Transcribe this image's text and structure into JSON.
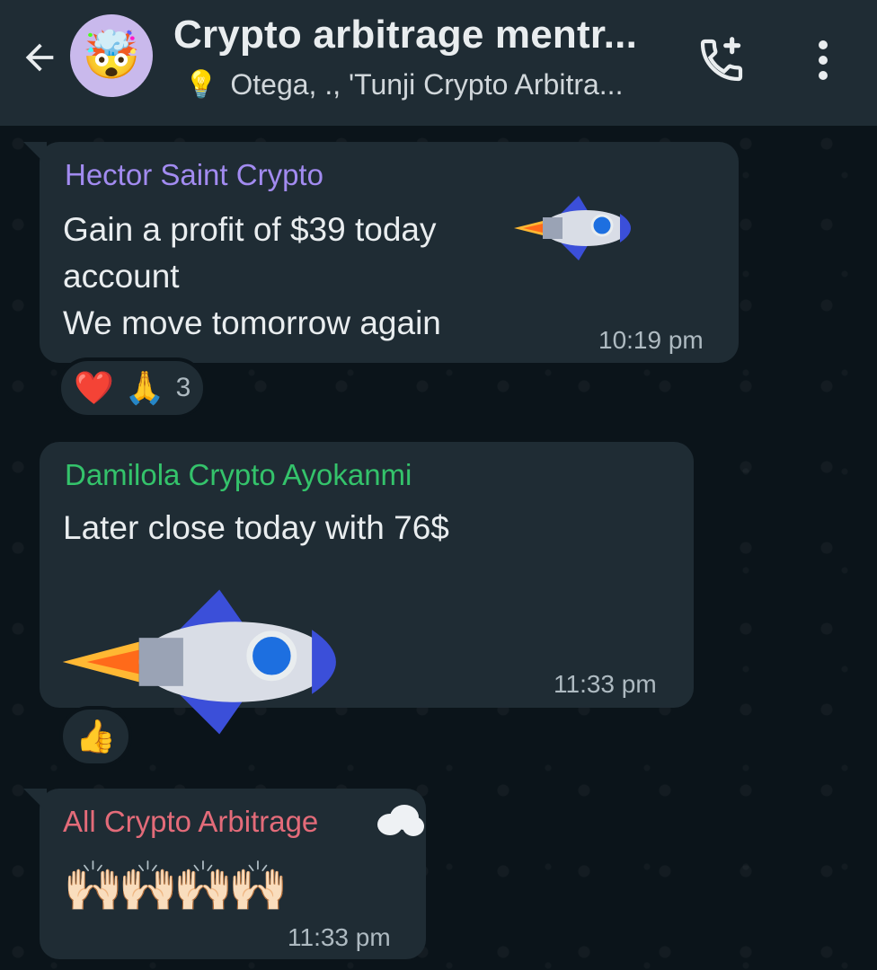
{
  "header": {
    "title": "Crypto arbitrage mentr...",
    "subtitle": "Otega, ., 'Tunji Crypto Arbitra...",
    "avatar_emoji": "🤯",
    "bulb_emoji": "💡",
    "icons": [
      "back-arrow-icon",
      "add-call-icon",
      "more-vertical-icon"
    ]
  },
  "messages": [
    {
      "sender": "Hector Saint Crypto",
      "sender_color": "#a28bf0",
      "line1": "Gain a profit of $39 today",
      "line2": "account",
      "line3": "We move tomorrow again",
      "time": "10:19 pm",
      "reactions": {
        "emojis": [
          "❤️",
          "🙏"
        ],
        "count": "3"
      }
    },
    {
      "sender": "Damilola Crypto Ayokanmi",
      "sender_color": "#34c36b",
      "line1": "Later close today with 76$",
      "time": "11:33 pm",
      "reactions": {
        "emojis": [
          "👍"
        ]
      }
    },
    {
      "sender": "All Crypto Arbitrage",
      "sender_color": "#e36b79",
      "line1": "🙌🏻🙌🏻🙌🏻🙌🏻",
      "time": "11:33 pm"
    }
  ]
}
